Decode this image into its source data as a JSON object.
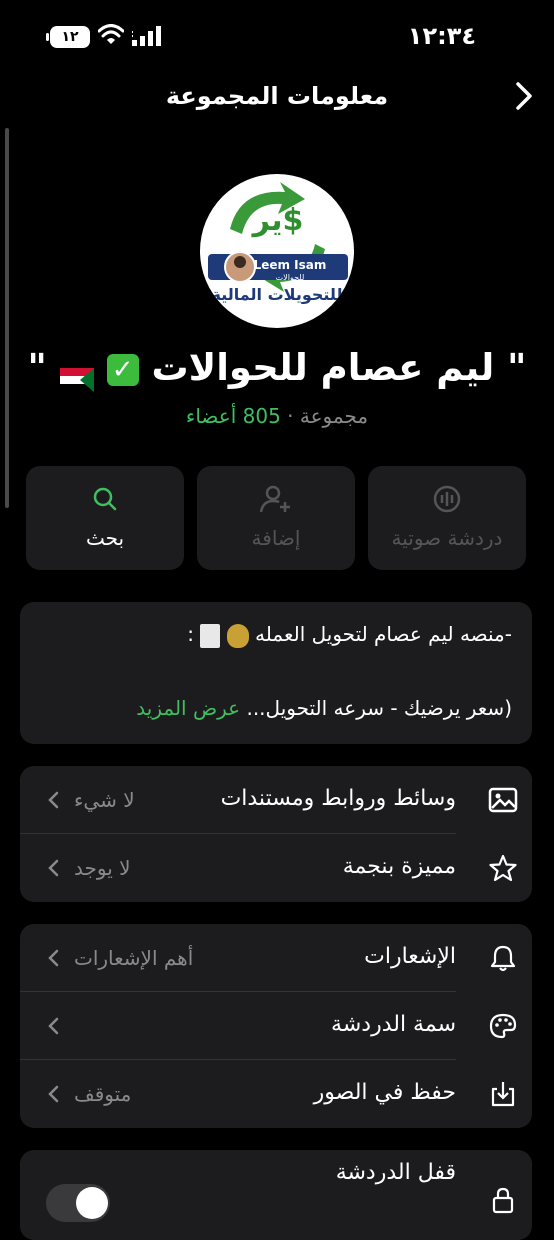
{
  "status_bar": {
    "time": "١٢:٣٤",
    "battery": "١٢"
  },
  "header": {
    "title": "معلومات المجموعة"
  },
  "group": {
    "logo_text": "ير$",
    "logo_banner_name": "Leem Isam",
    "logo_banner_sub": "للحوالات",
    "logo_tagline": "للتحويلات المالية",
    "name": "\" ليم عصام للحوالات",
    "name_suffix": "\"",
    "type": "مجموعة",
    "separator": " · ",
    "members": "805 أعضاء"
  },
  "actions": [
    {
      "label": "دردشة صوتية",
      "icon": "voice-chat-icon",
      "enabled": false
    },
    {
      "label": "إضافة",
      "icon": "add-member-icon",
      "enabled": false
    },
    {
      "label": "بحث",
      "icon": "search-icon",
      "enabled": true
    }
  ],
  "description": {
    "line1": "-منصه ليم عصام لتحويل العمله",
    "line1_suffix": ":",
    "line2": "(سعر يرضيك - سرعه التحويل...",
    "more": "عرض المزيد"
  },
  "media_section": {
    "rows": [
      {
        "label": "وسائط وروابط ومستندات",
        "value": "لا شيء",
        "icon": "photo-icon"
      },
      {
        "label": "مميزة بنجمة",
        "value": "لا يوجد",
        "icon": "star-icon"
      }
    ]
  },
  "settings_section": {
    "rows": [
      {
        "label": "الإشعارات",
        "value": "أهم الإشعارات",
        "icon": "bell-icon"
      },
      {
        "label": "سمة الدردشة",
        "value": "",
        "icon": "palette-icon"
      },
      {
        "label": "حفظ في الصور",
        "value": "متوقف",
        "icon": "save-to-photos-icon"
      }
    ]
  },
  "lock_section": {
    "label": "قفل الدردشة",
    "icon": "lock-icon",
    "toggle_on": false
  },
  "colors": {
    "accent_green": "#3fbf5f",
    "background": "#000000",
    "card": "#1c1c1e",
    "secondary_text": "#8a8a8a"
  }
}
